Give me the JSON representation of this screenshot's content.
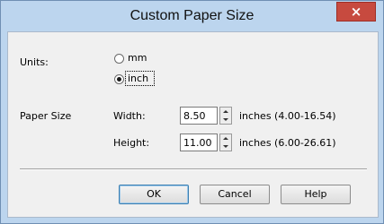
{
  "window": {
    "title": "Custom Paper Size",
    "close_glyph": "×"
  },
  "units": {
    "label": "Units:",
    "options": [
      {
        "label": "mm",
        "selected": false
      },
      {
        "label": "inch",
        "selected": true
      }
    ]
  },
  "paper_size": {
    "label": "Paper Size",
    "width": {
      "label": "Width:",
      "value": "8.50",
      "range_text": "inches (4.00-16.54)"
    },
    "height": {
      "label": "Height:",
      "value": "11.00",
      "range_text": "inches (6.00-26.61)"
    }
  },
  "buttons": {
    "ok": "OK",
    "cancel": "Cancel",
    "help": "Help"
  },
  "colors": {
    "title_bar": "#bcd5ee",
    "close_button": "#c74a3f",
    "client_bg": "#f0f0f0"
  }
}
